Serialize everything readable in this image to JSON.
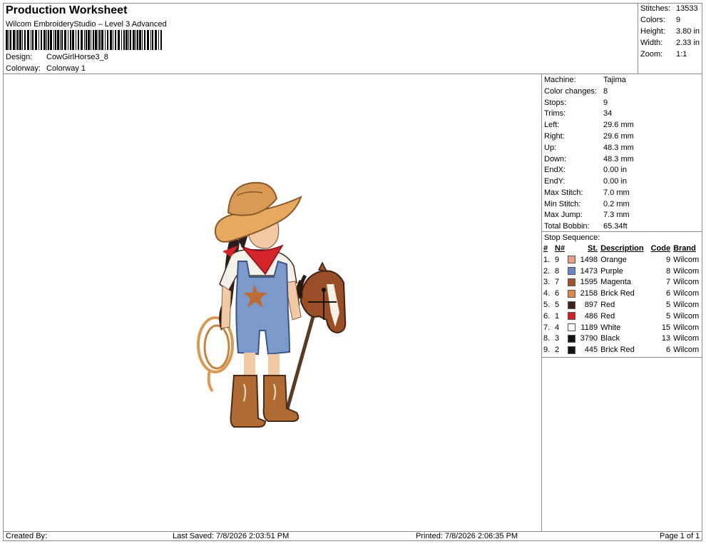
{
  "header": {
    "title": "Production Worksheet",
    "subtitle": "Wilcom EmbroideryStudio – Level 3 Advanced",
    "design_label": "Design:",
    "design_value": "CowGirlHorse3_8",
    "colorway_label": "Colorway:",
    "colorway_value": "Colorway 1"
  },
  "summary": [
    {
      "label": "Stitches:",
      "value": "13533"
    },
    {
      "label": "Colors:",
      "value": "9"
    },
    {
      "label": "Height:",
      "value": "3.80 in"
    },
    {
      "label": "Width:",
      "value": "2.33 in"
    },
    {
      "label": "Zoom:",
      "value": "1:1"
    }
  ],
  "machine": [
    {
      "label": "Machine:",
      "value": "Tajima"
    },
    {
      "label": "Color changes:",
      "value": "8"
    },
    {
      "label": "Stops:",
      "value": "9"
    },
    {
      "label": "Trims:",
      "value": "34"
    },
    {
      "label": "Left:",
      "value": "29.6 mm"
    },
    {
      "label": "Right:",
      "value": "29.6 mm"
    },
    {
      "label": "Up:",
      "value": "48.3 mm"
    },
    {
      "label": "Down:",
      "value": "48.3 mm"
    },
    {
      "label": "EndX:",
      "value": "0.00 in"
    },
    {
      "label": "EndY:",
      "value": "0.00 in"
    },
    {
      "label": "Max Stitch:",
      "value": "7.0 mm"
    },
    {
      "label": "Min Stitch:",
      "value": "0.2 mm"
    },
    {
      "label": "Max Jump:",
      "value": "7.3 mm"
    },
    {
      "label": "Total Bobbin:",
      "value": "65.34ft"
    }
  ],
  "stop_sequence": {
    "title": "Stop Sequence:",
    "columns": [
      "#",
      "N#",
      "St.",
      "Description",
      "Code",
      "Brand"
    ],
    "rows": [
      {
        "idx": "1.",
        "n": "9",
        "color": "#e8a184",
        "st": "1498",
        "desc": "Orange",
        "code": "9",
        "brand": "Wilcom"
      },
      {
        "idx": "2.",
        "n": "8",
        "color": "#6b86c4",
        "st": "1473",
        "desc": "Purple",
        "code": "8",
        "brand": "Wilcom"
      },
      {
        "idx": "3.",
        "n": "7",
        "color": "#a0502a",
        "st": "1595",
        "desc": "Magenta",
        "code": "7",
        "brand": "Wilcom"
      },
      {
        "idx": "4.",
        "n": "6",
        "color": "#e0894f",
        "st": "2158",
        "desc": "Brick Red",
        "code": "6",
        "brand": "Wilcom"
      },
      {
        "idx": "5.",
        "n": "5",
        "color": "#3b2418",
        "st": "897",
        "desc": "Red",
        "code": "5",
        "brand": "Wilcom"
      },
      {
        "idx": "6.",
        "n": "1",
        "color": "#d81f26",
        "st": "486",
        "desc": "Red",
        "code": "5",
        "brand": "Wilcom"
      },
      {
        "idx": "7.",
        "n": "4",
        "color": "#ffffff",
        "st": "1189",
        "desc": "White",
        "code": "15",
        "brand": "Wilcom"
      },
      {
        "idx": "8.",
        "n": "3",
        "color": "#111111",
        "st": "3790",
        "desc": "Black",
        "code": "13",
        "brand": "Wilcom"
      },
      {
        "idx": "9.",
        "n": "2",
        "color": "#1a1210",
        "st": "445",
        "desc": "Brick Red",
        "code": "6",
        "brand": "Wilcom"
      }
    ]
  },
  "footer": {
    "created_by": "Created By:",
    "last_saved": "Last Saved: 7/8/2026 2:03:51 PM",
    "printed": "Printed: 7/8/2026 2:06:35 PM",
    "page": "Page 1 of 1"
  }
}
